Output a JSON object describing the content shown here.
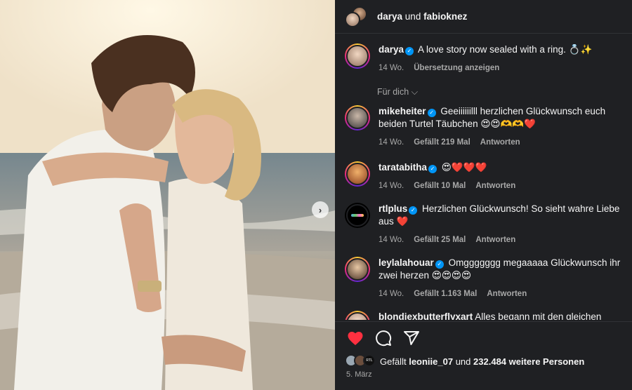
{
  "header": {
    "user1": "darya",
    "connector": "und",
    "user2": "fabioknez"
  },
  "caption": {
    "username": "darya",
    "text": "A love story now sealed with a ring. 💍✨",
    "time": "14 Wo.",
    "translate": "Übersetzung anzeigen"
  },
  "for_you": "Für dich ⌵",
  "comments": [
    {
      "username": "mikeheiter",
      "text": "Geeiiiiiilll herzlichen Glückwunsch euch beiden Turtel Täubchen 😍😍🫶🫶❤️",
      "time": "14 Wo.",
      "likes": "Gefällt 219 Mal",
      "reply": "Antworten"
    },
    {
      "username": "taratabitha",
      "text": "😍❤️❤️❤️",
      "time": "14 Wo.",
      "likes": "Gefällt 10 Mal",
      "reply": "Antworten"
    },
    {
      "username": "rtlplus",
      "text": "Herzlichen Glückwunsch! So sieht wahre Liebe aus ❤️",
      "time": "14 Wo.",
      "likes": "Gefällt 25 Mal",
      "reply": "Antworten"
    },
    {
      "username": "leylalahouar",
      "text": "Omggggggg megaaaaa Glückwunsch ihr zwei herzen 😍😍😍😍",
      "time": "14 Wo.",
      "likes": "Gefällt 1.163 Mal",
      "reply": "Antworten"
    },
    {
      "username": "blondiexbutterflyxart",
      "text": "Alles begann mit den gleichen"
    }
  ],
  "likes_line": {
    "prefix": "Gefällt",
    "user": "leoniie_07",
    "connector": "und",
    "count": "232.484 weitere Personen"
  },
  "date": "5. März",
  "colors": {
    "panel_bg": "#1f2023",
    "heart": "#ff3040",
    "verified": "#0095f6",
    "secondary_text": "#a8a8a8"
  },
  "icons": [
    "heart-icon",
    "comment-icon",
    "share-icon",
    "verified-icon",
    "next-arrow-icon"
  ]
}
